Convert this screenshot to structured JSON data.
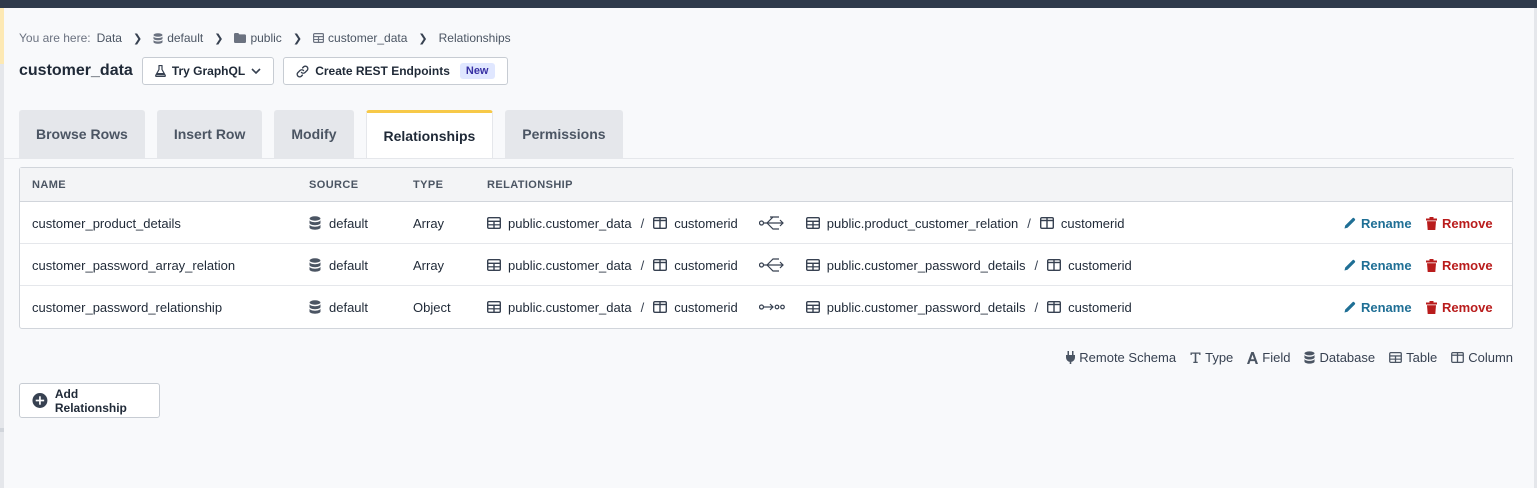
{
  "breadcrumb": {
    "prefix": "You are here:",
    "items": [
      "Data",
      "default",
      "public",
      "customer_data",
      "Relationships"
    ]
  },
  "header": {
    "title": "customer_data",
    "graphql_button": "Try GraphQL",
    "rest_button": "Create REST Endpoints",
    "rest_badge": "New"
  },
  "tabs": [
    {
      "label": "Browse Rows",
      "active": false
    },
    {
      "label": "Insert Row",
      "active": false
    },
    {
      "label": "Modify",
      "active": false
    },
    {
      "label": "Relationships",
      "active": true
    },
    {
      "label": "Permissions",
      "active": false
    }
  ],
  "table": {
    "headers": [
      "NAME",
      "SOURCE",
      "TYPE",
      "RELATIONSHIP"
    ],
    "rows": [
      {
        "name": "customer_product_details",
        "source": "default",
        "type": "Array",
        "from_table": "public.customer_data",
        "from_column": "customerid",
        "to_table": "public.product_customer_relation",
        "to_column": "customerid",
        "rename": "Rename",
        "remove": "Remove"
      },
      {
        "name": "customer_password_array_relation",
        "source": "default",
        "type": "Array",
        "from_table": "public.customer_data",
        "from_column": "customerid",
        "to_table": "public.customer_password_details",
        "to_column": "customerid",
        "rename": "Rename",
        "remove": "Remove"
      },
      {
        "name": "customer_password_relationship",
        "source": "default",
        "type": "Object",
        "from_table": "public.customer_data",
        "from_column": "customerid",
        "to_table": "public.customer_password_details",
        "to_column": "customerid",
        "rename": "Rename",
        "remove": "Remove"
      }
    ]
  },
  "legend": [
    "Remote Schema",
    "Type",
    "Field",
    "Database",
    "Table",
    "Column"
  ],
  "add_relationship_label": "Add Relationship",
  "colors": {
    "rename": "#1f6f95",
    "remove": "#b91c1c",
    "active_tab_accent": "#f7c948",
    "topbar": "#2f3a4b"
  },
  "icons": {
    "source": "database-icon",
    "table": "table-icon",
    "column": "column-icon",
    "array_relation": "array-relationship-icon",
    "object_relation": "object-relationship-icon",
    "rename": "pencil-icon",
    "remove": "trash-icon"
  }
}
